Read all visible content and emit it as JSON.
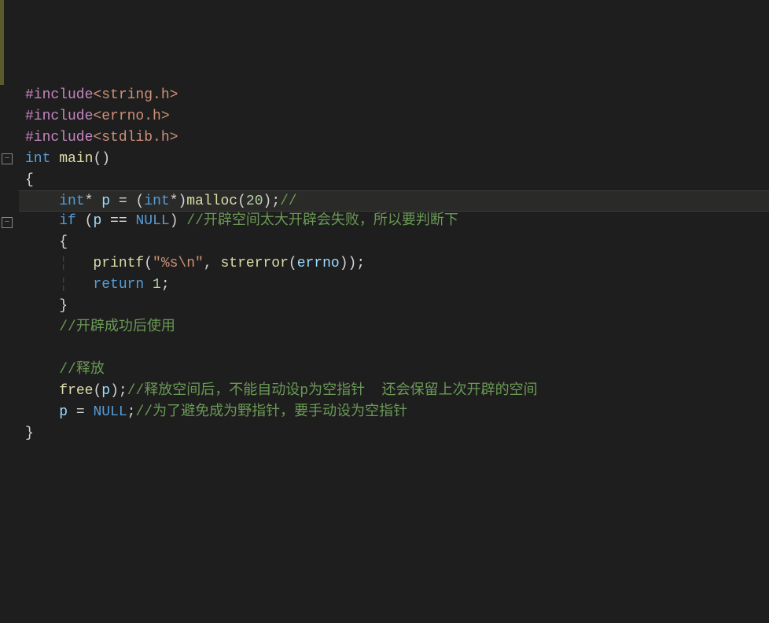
{
  "code": {
    "lines": [
      {
        "indent": 0,
        "tokens": [
          {
            "cls": "tok-pre",
            "t": "#include"
          },
          {
            "cls": "tok-inc",
            "t": "<string.h>"
          }
        ]
      },
      {
        "indent": 0,
        "tokens": [
          {
            "cls": "tok-pre",
            "t": "#include"
          },
          {
            "cls": "tok-inc",
            "t": "<errno.h>"
          }
        ]
      },
      {
        "indent": 0,
        "tokens": [
          {
            "cls": "tok-pre",
            "t": "#include"
          },
          {
            "cls": "tok-inc",
            "t": "<stdlib.h>"
          }
        ]
      },
      {
        "indent": 0,
        "fold": true,
        "tokens": [
          {
            "cls": "tok-kw",
            "t": "int"
          },
          {
            "cls": "tok-op",
            "t": " "
          },
          {
            "cls": "tok-fn",
            "t": "main"
          },
          {
            "cls": "tok-punc",
            "t": "()"
          }
        ]
      },
      {
        "indent": 0,
        "tokens": [
          {
            "cls": "tok-punc",
            "t": "{"
          }
        ]
      },
      {
        "indent": 1,
        "highlight": true,
        "tokens": [
          {
            "cls": "tok-kw",
            "t": "int"
          },
          {
            "cls": "tok-op",
            "t": "* "
          },
          {
            "cls": "tok-id",
            "t": "p"
          },
          {
            "cls": "tok-op",
            "t": " = ("
          },
          {
            "cls": "tok-kw",
            "t": "int"
          },
          {
            "cls": "tok-op",
            "t": "*)"
          },
          {
            "cls": "tok-fn",
            "t": "malloc"
          },
          {
            "cls": "tok-punc",
            "t": "("
          },
          {
            "cls": "tok-num",
            "t": "20"
          },
          {
            "cls": "tok-punc",
            "t": ");"
          },
          {
            "cls": "tok-cmt",
            "t": "//"
          }
        ]
      },
      {
        "indent": 1,
        "fold": true,
        "tokens": [
          {
            "cls": "tok-kw",
            "t": "if"
          },
          {
            "cls": "tok-op",
            "t": " ("
          },
          {
            "cls": "tok-id",
            "t": "p"
          },
          {
            "cls": "tok-op",
            "t": " == "
          },
          {
            "cls": "tok-null",
            "t": "NULL"
          },
          {
            "cls": "tok-punc",
            "t": ") "
          },
          {
            "cls": "tok-cmt",
            "t": "//开辟空间太大开辟会失败，所以要判断下"
          }
        ]
      },
      {
        "indent": 1,
        "tokens": [
          {
            "cls": "tok-punc",
            "t": "{"
          }
        ]
      },
      {
        "indent": 2,
        "tokens": [
          {
            "cls": "tok-fn",
            "t": "printf"
          },
          {
            "cls": "tok-punc",
            "t": "("
          },
          {
            "cls": "tok-str",
            "t": "\"%s\\n\""
          },
          {
            "cls": "tok-punc",
            "t": ", "
          },
          {
            "cls": "tok-fn",
            "t": "strerror"
          },
          {
            "cls": "tok-punc",
            "t": "("
          },
          {
            "cls": "tok-errno",
            "t": "errno"
          },
          {
            "cls": "tok-punc",
            "t": "));"
          }
        ]
      },
      {
        "indent": 2,
        "tokens": [
          {
            "cls": "tok-kw",
            "t": "return"
          },
          {
            "cls": "tok-op",
            "t": " "
          },
          {
            "cls": "tok-num",
            "t": "1"
          },
          {
            "cls": "tok-punc",
            "t": ";"
          }
        ]
      },
      {
        "indent": 1,
        "tokens": [
          {
            "cls": "tok-punc",
            "t": "}"
          }
        ]
      },
      {
        "indent": 1,
        "tokens": [
          {
            "cls": "tok-cmt",
            "t": "//开辟成功后使用"
          }
        ]
      },
      {
        "indent": 1,
        "tokens": []
      },
      {
        "indent": 1,
        "tokens": [
          {
            "cls": "tok-cmt",
            "t": "//释放"
          }
        ]
      },
      {
        "indent": 1,
        "tokens": [
          {
            "cls": "tok-fn",
            "t": "free"
          },
          {
            "cls": "tok-punc",
            "t": "("
          },
          {
            "cls": "tok-id",
            "t": "p"
          },
          {
            "cls": "tok-punc",
            "t": ");"
          },
          {
            "cls": "tok-cmt",
            "t": "//释放空间后，不能自动设p为空指针  还会保留上次开辟的空间"
          }
        ]
      },
      {
        "indent": 1,
        "tokens": [
          {
            "cls": "tok-id",
            "t": "p"
          },
          {
            "cls": "tok-op",
            "t": " = "
          },
          {
            "cls": "tok-null",
            "t": "NULL"
          },
          {
            "cls": "tok-punc",
            "t": ";"
          },
          {
            "cls": "tok-cmt",
            "t": "//为了避免成为野指针，要手动设为空指针"
          }
        ]
      },
      {
        "indent": 0,
        "tokens": [
          {
            "cls": "tok-punc",
            "t": "}"
          }
        ]
      }
    ]
  },
  "fold_symbol": "−",
  "indent_unit": "    ",
  "indent_guide": "¦   "
}
